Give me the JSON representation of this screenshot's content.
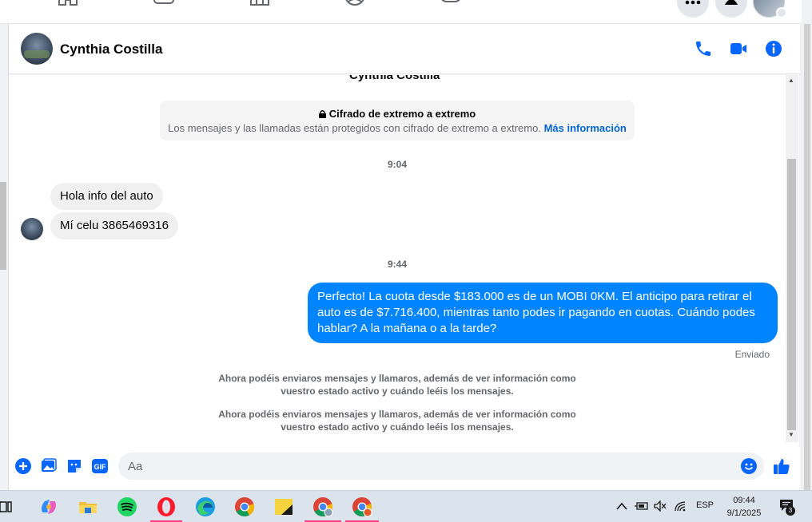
{
  "header": {
    "contact_name": "Cynthia Costilla"
  },
  "conversation": {
    "top_name": "Cynthia Costilla",
    "encryption_title": "Cifrado de extremo a extremo",
    "encryption_text": "Los mensajes y las llamadas están protegidos con cifrado de extremo a extremo.",
    "encryption_link": "Más información",
    "time_1": "9:04",
    "incoming": [
      {
        "text": "Hola info del auto"
      },
      {
        "text": "Mí celu 3865469316"
      }
    ],
    "time_2": "9:44",
    "outgoing_text": "Perfecto! La cuota desde $183.000 es de un MOBI 0KM. El anticipo para retirar el auto es de $7.716.400, mientras tanto podes ir pagando en cuotas. Cuándo podes hablar? A la mañana o a la tarde?",
    "status": "Enviado",
    "notices": [
      {
        "line1": "Ahora podéis enviaros mensajes y llamaros, además de ver información como",
        "line2": "vuestro estado activo y cuándo leéis los mensajes."
      },
      {
        "line1": "Ahora podéis enviaros mensajes y llamaros, además de ver información como",
        "line2": "vuestro estado activo y cuándo leéis los mensajes."
      }
    ]
  },
  "composer": {
    "placeholder": "Aa"
  },
  "taskbar": {
    "language": "ESP",
    "time": "09:44",
    "date": "9/1/2025",
    "notification_count": "3"
  },
  "colors": {
    "accent": "#0866ff",
    "bubble_out": "#0084ff",
    "bubble_in": "#f0f0f0"
  }
}
